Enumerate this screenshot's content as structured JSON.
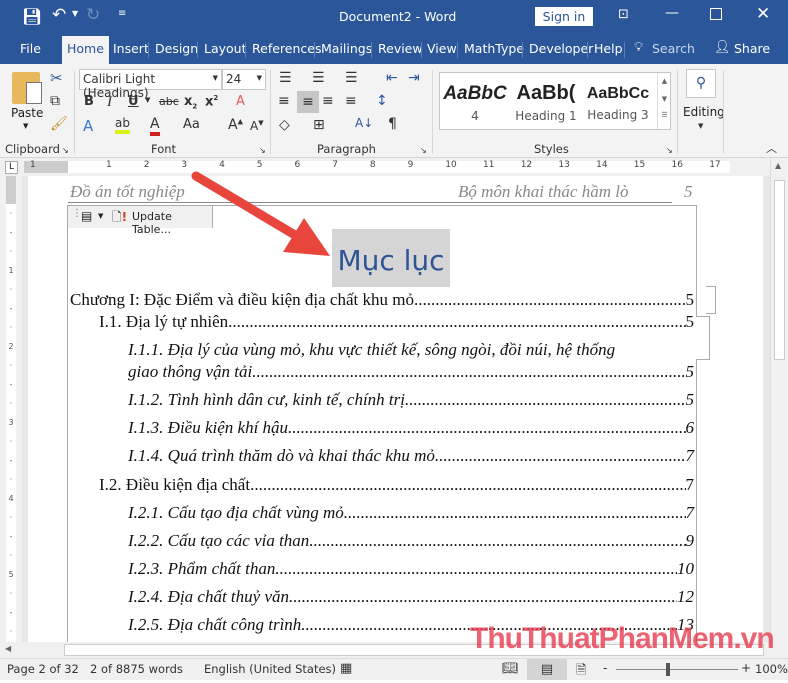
{
  "titlebar": {
    "document_title": "Document2  -  Word",
    "sign_in": "Sign in"
  },
  "tabs": [
    "File",
    "Home",
    "Insert",
    "Design",
    "Layout",
    "References",
    "Mailings",
    "Review",
    "View",
    "MathType",
    "Developer",
    "Help"
  ],
  "search_label": "Search",
  "share_label": "Share",
  "ribbon": {
    "clipboard": {
      "paste": "Paste",
      "label": "Clipboard"
    },
    "font": {
      "name": "Calibri Light (Headings)",
      "size": "24",
      "label": "Font"
    },
    "paragraph": {
      "label": "Paragraph"
    },
    "styles": {
      "label": "Styles",
      "items": [
        {
          "preview": "AaBbC",
          "name": "4"
        },
        {
          "preview": "AaBb(",
          "name": "Heading 1"
        },
        {
          "preview": "AaBbCc",
          "name": "Heading 3"
        }
      ]
    },
    "editing": {
      "label": "Editing"
    }
  },
  "ruler_numbers": [
    "1",
    "1",
    "2",
    "3",
    "4",
    "5",
    "6",
    "7",
    "8",
    "9",
    "10",
    "11",
    "12",
    "13",
    "14",
    "15",
    "16",
    "17"
  ],
  "document": {
    "header_left": "Đồ án tốt nghiệp",
    "header_right": "Bộ môn khai thác hầm lò",
    "header_page": "5",
    "update_table": "Update Table...",
    "toc_title": "Mục lục",
    "entries": [
      {
        "title": "Chương I: Đặc Điểm và điều kiện địa chất khu mỏ",
        "page": "5"
      },
      {
        "title": "I.1. Địa lý tự  nhiên",
        "page": "5"
      },
      {
        "title": "I.1.1. Địa lý của vùng mỏ, khu vực thiết kế, sông ngòi, đồi núi, hệ thống",
        "title_cont": "giao thông vận tải ",
        "page": "5"
      },
      {
        "title": "I.1.2.  Tình hình dân cư, kinh tế, chính trị ",
        "page": "5"
      },
      {
        "title": "I.1.3. Điều kiện khí hậu",
        "page": "6"
      },
      {
        "title": "I.1.4. Quá trình thăm dò và khai thác khu mỏ ",
        "page": "7"
      },
      {
        "title": "I.2. Điều kiện địa chất ",
        "page": "7"
      },
      {
        "title": "I.2.1. Cấu tạo địa chất vùng mỏ",
        "page": "7"
      },
      {
        "title": "I.2.2. Cấu tạo các vỉa than",
        "page": "9"
      },
      {
        "title": "I.2.3. Phẩm chất than",
        "page": "10"
      },
      {
        "title": "I.2.4. Địa chất thuỷ văn ",
        "page": "12"
      },
      {
        "title": "I.2.5. Địa chất công trình",
        "page": "13"
      }
    ]
  },
  "status": {
    "page": "Page 2 of 32",
    "words": "2 of 8875 words",
    "language": "English (United States)",
    "zoom": "100%"
  },
  "zoom_level_percent": 100,
  "watermark": "ThuThuatPhanMem.vn",
  "colors": {
    "brand": "#2b579a",
    "heading": "#2f5496",
    "arrow": "#e8453c"
  }
}
